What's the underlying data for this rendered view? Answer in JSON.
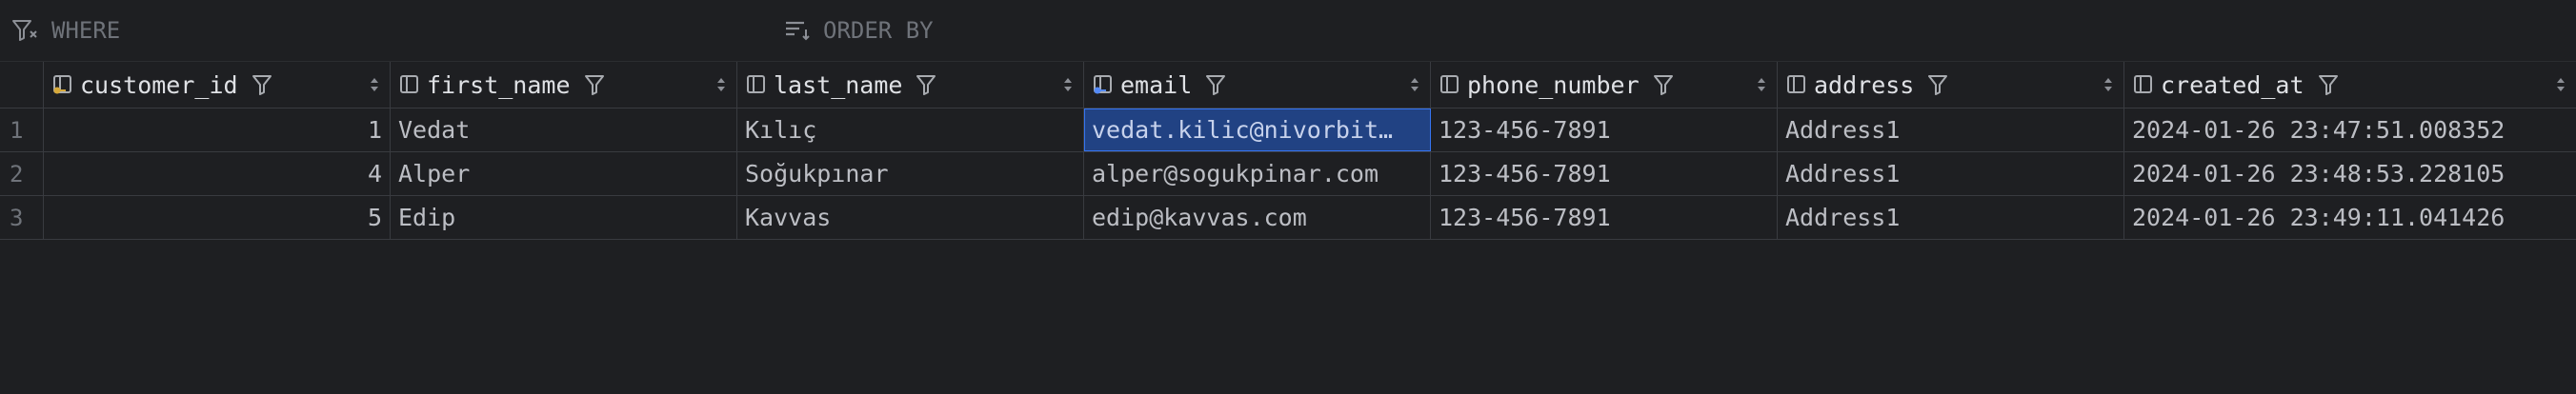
{
  "filter_bar": {
    "where_label": "WHERE",
    "order_by_label": "ORDER BY"
  },
  "table": {
    "columns": [
      {
        "name": "customer_id",
        "icon": "primary-key-column-icon"
      },
      {
        "name": "first_name",
        "icon": "column-icon"
      },
      {
        "name": "last_name",
        "icon": "column-icon"
      },
      {
        "name": "email",
        "icon": "unique-column-icon"
      },
      {
        "name": "phone_number",
        "icon": "column-icon"
      },
      {
        "name": "address",
        "icon": "column-icon"
      },
      {
        "name": "created_at",
        "icon": "column-icon"
      }
    ],
    "rows": [
      {
        "num": "1",
        "cells": [
          "1",
          "Vedat",
          "Kılıç",
          "vedat.kilic@nivorbit…",
          "123-456-7891",
          "Address1",
          "2024-01-26 23:47:51.008352"
        ]
      },
      {
        "num": "2",
        "cells": [
          "4",
          "Alper",
          "Soğukpınar",
          "alper@sogukpinar.com",
          "123-456-7891",
          "Address1",
          "2024-01-26 23:48:53.228105"
        ]
      },
      {
        "num": "3",
        "cells": [
          "5",
          "Edip",
          "Kavvas",
          "edip@kavvas.com",
          "123-456-7891",
          "Address1",
          "2024-01-26 23:49:11.041426"
        ]
      }
    ],
    "selected_cell": {
      "row": 0,
      "col": 3
    }
  },
  "colors": {
    "background": "#1e1f22",
    "selection": "#214283",
    "key_icon": "#d6a93a",
    "unique_icon": "#548af7"
  }
}
